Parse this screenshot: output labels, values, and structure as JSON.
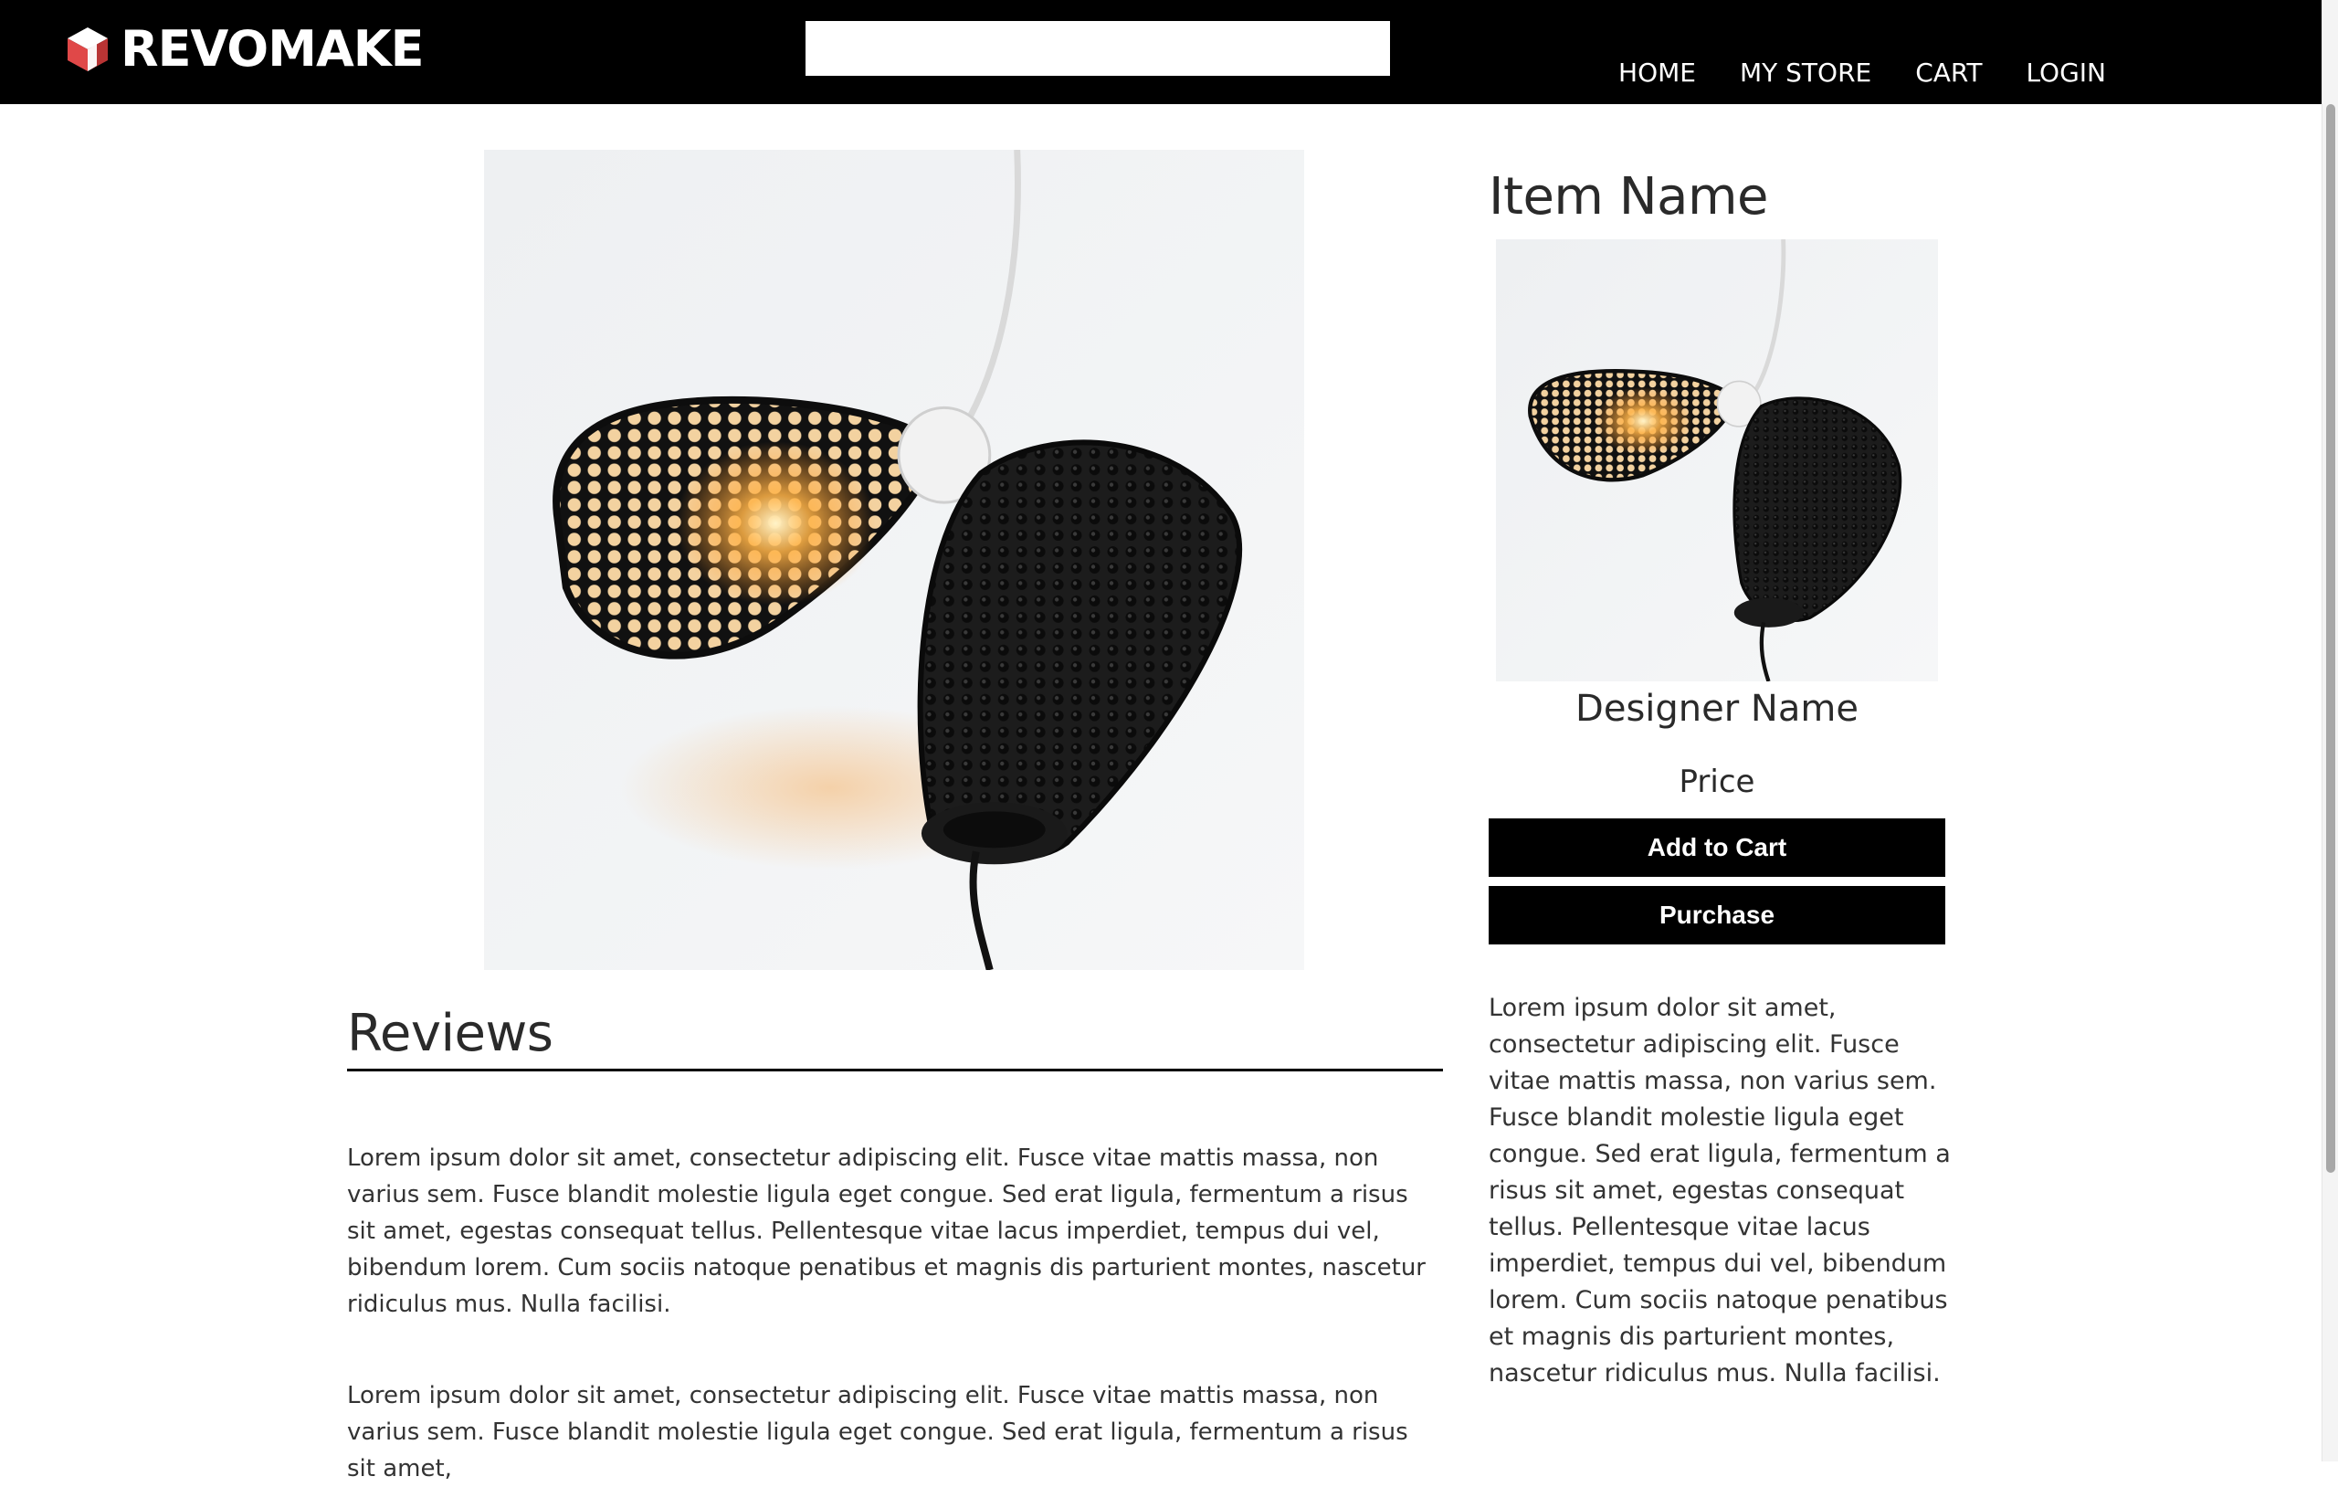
{
  "header": {
    "logo_text": "REVOMAKE",
    "logo_icon": "cube-icon",
    "search_value": "",
    "search_placeholder": "",
    "nav": {
      "home": "HOME",
      "my_store": "MY STORE",
      "cart": "CART",
      "login": "LOGIN"
    }
  },
  "product": {
    "name": "Item Name",
    "designer": "Designer Name",
    "price": "Price",
    "add_to_cart_label": "Add to Cart",
    "purchase_label": "Purchase",
    "description": "Lorem ipsum dolor sit amet, consectetur adipiscing elit. Fusce vitae mattis massa, non varius sem. Fusce blandit molestie ligula eget congue. Sed erat ligula, fermentum a risus sit amet, egestas consequat tellus. Pellentesque vitae lacus imperdiet, tempus dui vel, bibendum lorem. Cum sociis natoque penatibus et magnis dis parturient montes, nascetur ridiculus mus. Nulla facilisi."
  },
  "reviews": {
    "heading": "Reviews",
    "items": [
      "Lorem ipsum dolor sit amet, consectetur adipiscing elit. Fusce vitae mattis massa, non varius sem. Fusce blandit molestie ligula eget congue. Sed erat ligula, fermentum a risus sit amet, egestas consequat tellus. Pellentesque vitae lacus imperdiet, tempus dui vel, bibendum lorem. Cum sociis natoque penatibus et magnis dis parturient montes, nascetur ridiculus mus. Nulla facilisi.",
      "Lorem ipsum dolor sit amet, consectetur adipiscing elit. Fusce vitae mattis massa, non varius sem. Fusce blandit molestie ligula eget congue. Sed erat ligula, fermentum a risus sit amet,"
    ]
  },
  "colors": {
    "header_bg": "#000000",
    "logo_accent": "#e04848",
    "button_bg": "#000000",
    "button_text": "#ffffff"
  }
}
